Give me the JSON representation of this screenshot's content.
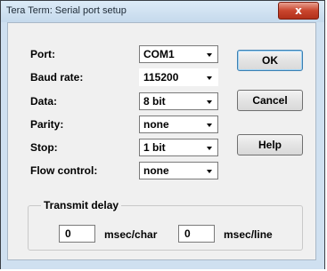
{
  "window": {
    "title": "Tera Term: Serial port setup",
    "close_glyph": "x"
  },
  "fields": {
    "port": {
      "label": "Port:",
      "value": "COM1"
    },
    "baud": {
      "label": "Baud rate:",
      "value": "115200"
    },
    "data": {
      "label": "Data:",
      "value": "8 bit"
    },
    "parity": {
      "label": "Parity:",
      "value": "none"
    },
    "stop": {
      "label": "Stop:",
      "value": "1 bit"
    },
    "flow": {
      "label": "Flow control:",
      "value": "none"
    }
  },
  "buttons": {
    "ok": "OK",
    "cancel": "Cancel",
    "help": "Help"
  },
  "transmit_delay": {
    "legend": "Transmit delay",
    "char_value": "0",
    "char_unit": "msec/char",
    "line_value": "0",
    "line_unit": "msec/line"
  },
  "colors": {
    "frame": "#cfe0f0",
    "client": "#f0f0f0",
    "close": "#c9452d"
  }
}
